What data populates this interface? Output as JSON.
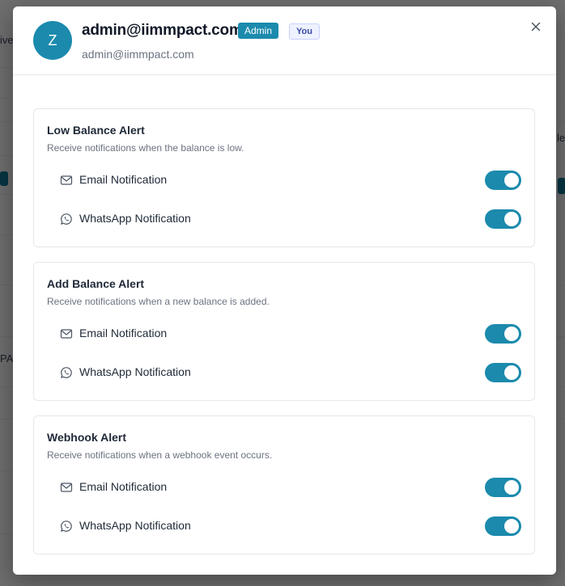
{
  "user": {
    "avatar_initial": "Z",
    "name": "admin@iimmpact.com",
    "role_badge": "Admin",
    "self_badge": "You",
    "email": "admin@iimmpact.com"
  },
  "close_icon": "close-icon",
  "colors": {
    "accent": "#1b8aad",
    "toggle_on": "#1b8aad",
    "overlay": "rgba(0,0,0,0.55)"
  },
  "alerts": [
    {
      "title": "Low Balance Alert",
      "description": "Receive notifications when the balance is low.",
      "channels": [
        {
          "icon": "mail-icon",
          "label": "Email Notification",
          "enabled": true
        },
        {
          "icon": "whatsapp-icon",
          "label": "WhatsApp Notification",
          "enabled": true
        }
      ]
    },
    {
      "title": "Add Balance Alert",
      "description": "Receive notifications when a new balance is added.",
      "channels": [
        {
          "icon": "mail-icon",
          "label": "Email Notification",
          "enabled": true
        },
        {
          "icon": "whatsapp-icon",
          "label": "WhatsApp Notification",
          "enabled": true
        }
      ]
    },
    {
      "title": "Webhook Alert",
      "description": "Receive notifications when a webhook event occurs.",
      "channels": [
        {
          "icon": "mail-icon",
          "label": "Email Notification",
          "enabled": true
        },
        {
          "icon": "whatsapp-icon",
          "label": "WhatsApp Notification",
          "enabled": true
        }
      ]
    }
  ],
  "background_fragments": {
    "left_1": "ive",
    "left_2": "PA",
    "right_1": "le"
  }
}
